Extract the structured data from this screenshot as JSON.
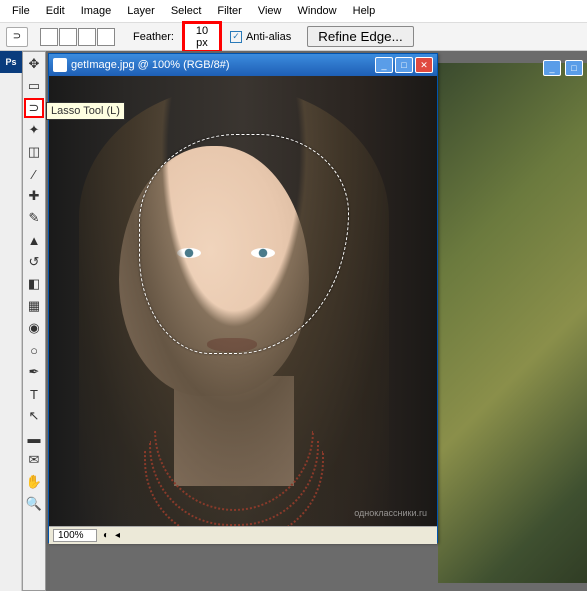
{
  "menu": [
    "File",
    "Edit",
    "Image",
    "Layer",
    "Select",
    "Filter",
    "View",
    "Window",
    "Help"
  ],
  "options": {
    "feather_label": "Feather:",
    "feather_value": "10 px",
    "antialias_label": "Anti-alias",
    "refine_label": "Refine Edge..."
  },
  "tooltip": "Lasso Tool (L)",
  "doc": {
    "title": "getImage.jpg @ 100% (RGB/8#)",
    "zoom": "100%",
    "watermark": "одноклассники.ru"
  },
  "tools": [
    {
      "name": "move-icon",
      "glyph": "✥"
    },
    {
      "name": "marquee-icon",
      "glyph": "▭"
    },
    {
      "name": "lasso-icon",
      "glyph": "⊃",
      "selected": true
    },
    {
      "name": "wand-icon",
      "glyph": "✦"
    },
    {
      "name": "crop-icon",
      "glyph": "◫"
    },
    {
      "name": "eyedropper-icon",
      "glyph": "⁄"
    },
    {
      "name": "healing-icon",
      "glyph": "✚"
    },
    {
      "name": "brush-icon",
      "glyph": "✎"
    },
    {
      "name": "stamp-icon",
      "glyph": "▲"
    },
    {
      "name": "history-brush-icon",
      "glyph": "↺"
    },
    {
      "name": "eraser-icon",
      "glyph": "◧"
    },
    {
      "name": "gradient-icon",
      "glyph": "▦"
    },
    {
      "name": "blur-icon",
      "glyph": "◉"
    },
    {
      "name": "dodge-icon",
      "glyph": "○"
    },
    {
      "name": "pen-icon",
      "glyph": "✒"
    },
    {
      "name": "type-icon",
      "glyph": "T"
    },
    {
      "name": "path-icon",
      "glyph": "↖"
    },
    {
      "name": "shape-icon",
      "glyph": "▬"
    },
    {
      "name": "notes-icon",
      "glyph": "✉"
    },
    {
      "name": "hand-icon",
      "glyph": "✋"
    },
    {
      "name": "zoom-icon",
      "glyph": "🔍"
    }
  ]
}
